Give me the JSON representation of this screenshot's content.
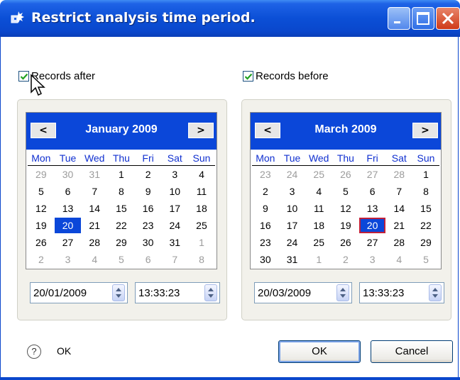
{
  "window": {
    "title": "Restrict analysis time period."
  },
  "after": {
    "checkbox_label": "Records after",
    "checked": true,
    "month_label": "January 2009",
    "prev_symbol": "<",
    "next_symbol": ">",
    "weekdays": [
      "Mon",
      "Tue",
      "Wed",
      "Thu",
      "Fri",
      "Sat",
      "Sun"
    ],
    "weeks": [
      [
        {
          "d": "29",
          "o": 1
        },
        {
          "d": "30",
          "o": 1
        },
        {
          "d": "31",
          "o": 1
        },
        {
          "d": "1"
        },
        {
          "d": "2"
        },
        {
          "d": "3"
        },
        {
          "d": "4"
        }
      ],
      [
        {
          "d": "5"
        },
        {
          "d": "6"
        },
        {
          "d": "7"
        },
        {
          "d": "8"
        },
        {
          "d": "9"
        },
        {
          "d": "10"
        },
        {
          "d": "11"
        }
      ],
      [
        {
          "d": "12"
        },
        {
          "d": "13"
        },
        {
          "d": "14"
        },
        {
          "d": "15"
        },
        {
          "d": "16"
        },
        {
          "d": "17"
        },
        {
          "d": "18"
        }
      ],
      [
        {
          "d": "19"
        },
        {
          "d": "20",
          "s": 1
        },
        {
          "d": "21"
        },
        {
          "d": "22"
        },
        {
          "d": "23"
        },
        {
          "d": "24"
        },
        {
          "d": "25"
        }
      ],
      [
        {
          "d": "26"
        },
        {
          "d": "27"
        },
        {
          "d": "28"
        },
        {
          "d": "29"
        },
        {
          "d": "30"
        },
        {
          "d": "31"
        },
        {
          "d": "1",
          "o": 1
        }
      ],
      [
        {
          "d": "2",
          "o": 1
        },
        {
          "d": "3",
          "o": 1
        },
        {
          "d": "4",
          "o": 1
        },
        {
          "d": "5",
          "o": 1
        },
        {
          "d": "6",
          "o": 1
        },
        {
          "d": "7",
          "o": 1
        },
        {
          "d": "8",
          "o": 1
        }
      ]
    ],
    "date_value": "20/01/2009",
    "time_value": "13:33:23"
  },
  "before": {
    "checkbox_label": "Records before",
    "checked": true,
    "month_label": "March 2009",
    "prev_symbol": "<",
    "next_symbol": ">",
    "weekdays": [
      "Mon",
      "Tue",
      "Wed",
      "Thu",
      "Fri",
      "Sat",
      "Sun"
    ],
    "weeks": [
      [
        {
          "d": "23",
          "o": 1
        },
        {
          "d": "24",
          "o": 1
        },
        {
          "d": "25",
          "o": 1
        },
        {
          "d": "26",
          "o": 1
        },
        {
          "d": "27",
          "o": 1
        },
        {
          "d": "28",
          "o": 1
        },
        {
          "d": "1"
        }
      ],
      [
        {
          "d": "2"
        },
        {
          "d": "3"
        },
        {
          "d": "4"
        },
        {
          "d": "5"
        },
        {
          "d": "6"
        },
        {
          "d": "7"
        },
        {
          "d": "8"
        }
      ],
      [
        {
          "d": "9"
        },
        {
          "d": "10"
        },
        {
          "d": "11"
        },
        {
          "d": "12"
        },
        {
          "d": "13"
        },
        {
          "d": "14"
        },
        {
          "d": "15"
        }
      ],
      [
        {
          "d": "16"
        },
        {
          "d": "17"
        },
        {
          "d": "18"
        },
        {
          "d": "19"
        },
        {
          "d": "20",
          "s": 1,
          "t": 1
        },
        {
          "d": "21"
        },
        {
          "d": "22"
        }
      ],
      [
        {
          "d": "23"
        },
        {
          "d": "24"
        },
        {
          "d": "25"
        },
        {
          "d": "26"
        },
        {
          "d": "27"
        },
        {
          "d": "28"
        },
        {
          "d": "29"
        }
      ],
      [
        {
          "d": "30"
        },
        {
          "d": "31"
        },
        {
          "d": "1",
          "o": 1
        },
        {
          "d": "2",
          "o": 1
        },
        {
          "d": "3",
          "o": 1
        },
        {
          "d": "4",
          "o": 1
        },
        {
          "d": "5",
          "o": 1
        }
      ]
    ],
    "date_value": "20/03/2009",
    "time_value": "13:33:23"
  },
  "footer": {
    "help_symbol": "?",
    "status_text": "OK",
    "ok_label": "OK",
    "cancel_label": "Cancel"
  },
  "colors": {
    "title_bar": "#0a47cc",
    "calendar_header": "#0b47d9",
    "today_outline": "#c0203a"
  },
  "icons": [
    "app-icon",
    "minimize-icon",
    "maximize-icon",
    "close-icon",
    "checkmark-icon",
    "spinner-arrows-icon",
    "help-icon",
    "mouse-cursor-icon"
  ]
}
